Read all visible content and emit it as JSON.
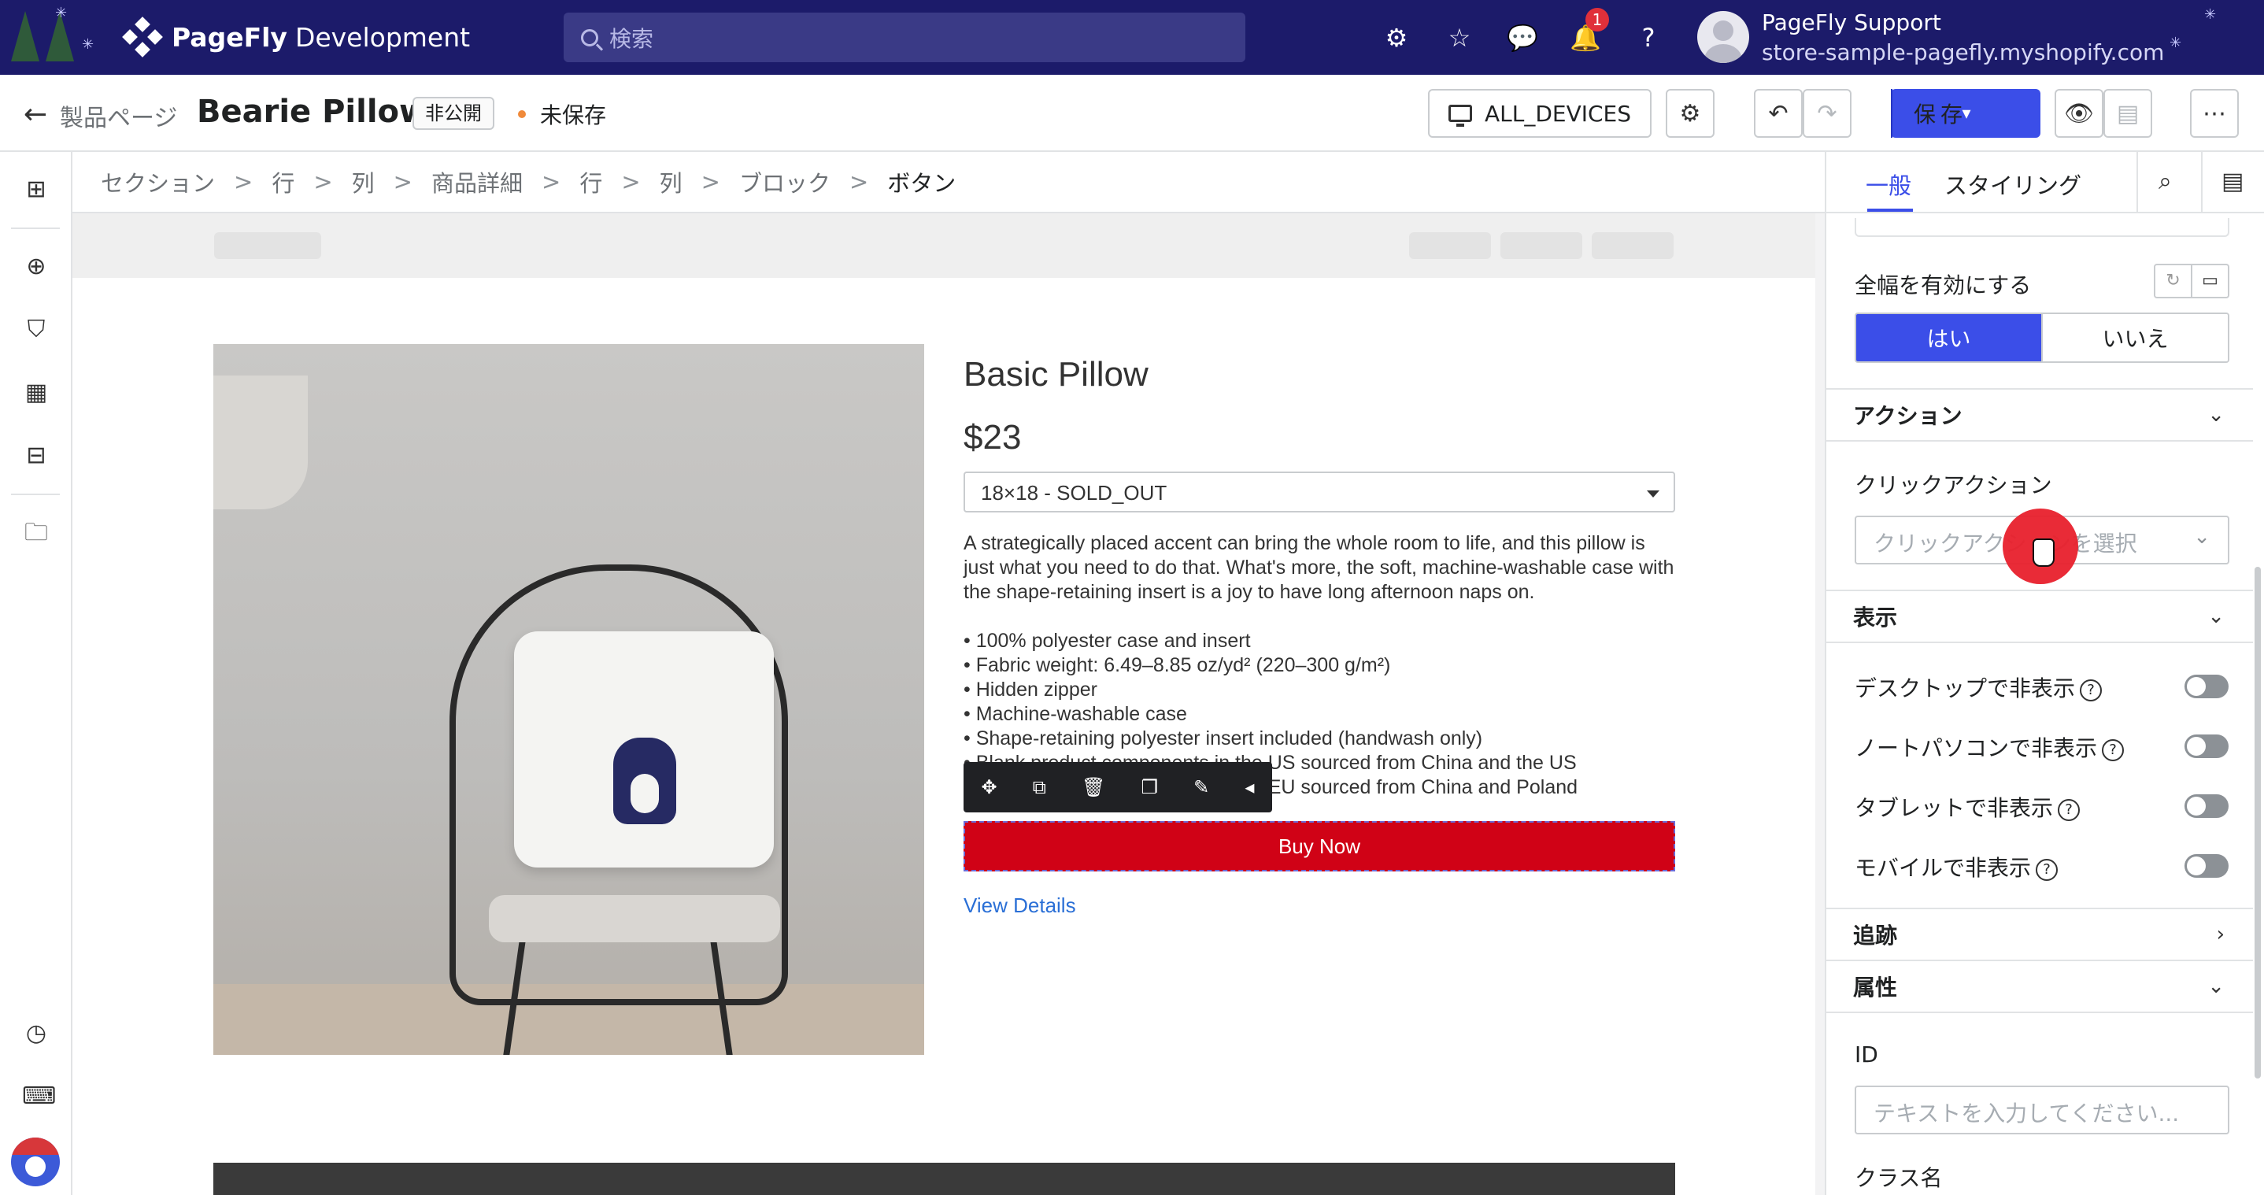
{
  "topbar": {
    "brand_strong": "PageFly",
    "brand_rest": "Development",
    "search_placeholder": "検索",
    "notification_count": "1",
    "account_name": "PageFly Support",
    "account_store": "store-sample-pagefly.myshopify.com",
    "colors": {
      "background": "#1c1b6a",
      "badge": "#e0303a"
    }
  },
  "toolbar": {
    "back_label": "製品ページ",
    "page_name": "Bearie Pillow",
    "status_badge": "非公開",
    "unsaved_label": "未保存",
    "devices_label": "ALL_DEVICES",
    "save_label": "保存",
    "colors": {
      "save": "#3b4ee8",
      "unsaved_dot": "#f08a3a"
    }
  },
  "breadcrumb": {
    "items": [
      "セクション",
      "行",
      "列",
      "商品詳細",
      "行",
      "列",
      "ブロック",
      "ボタン"
    ],
    "separator": ">"
  },
  "product": {
    "title": "Basic Pillow",
    "price": "$23",
    "variant": "18×18 - SOLD_OUT",
    "description": "A strategically placed accent can bring the whole room to life, and this pillow is just what you need to do that. What's more, the soft, machine-washable case with the shape-retaining insert is a joy to have long afternoon naps on.",
    "bullets": [
      "• 100% polyester case and insert",
      "• Fabric weight: 6.49–8.85 oz/yd² (220–300 g/m²)",
      "• Hidden zipper",
      "• Machine-washable case",
      "• Shape-retaining polyester insert included (handwash only)",
      "• Blank product components in the US sourced from China and the US",
      "• Blank product components in the EU sourced from China and Poland"
    ],
    "buy_label": "Buy Now",
    "details_label": "View Details",
    "colors": {
      "buy_button": "#d00216",
      "link": "#2a6fd6"
    }
  },
  "panel": {
    "tab_general": "一般",
    "tab_styling": "スタイリング",
    "fullwidth_label": "全幅を有効にする",
    "yes_label": "はい",
    "no_label": "いいえ",
    "action_section": "アクション",
    "click_action_label": "クリックアクション",
    "click_action_placeholder": "クリックアクションを選択",
    "display_section": "表示",
    "hide_desktop": "デスクトップで非表示",
    "hide_laptop": "ノートパソコンで非表示",
    "hide_tablet": "タブレットで非表示",
    "hide_mobile": "モバイルで非表示",
    "tracking_section": "追跡",
    "attributes_section": "属性",
    "id_label": "ID",
    "id_placeholder": "テキストを入力してください...",
    "class_label": "クラス名",
    "colors": {
      "accent": "#3b4ee8",
      "click_marker": "#e8202c"
    }
  }
}
